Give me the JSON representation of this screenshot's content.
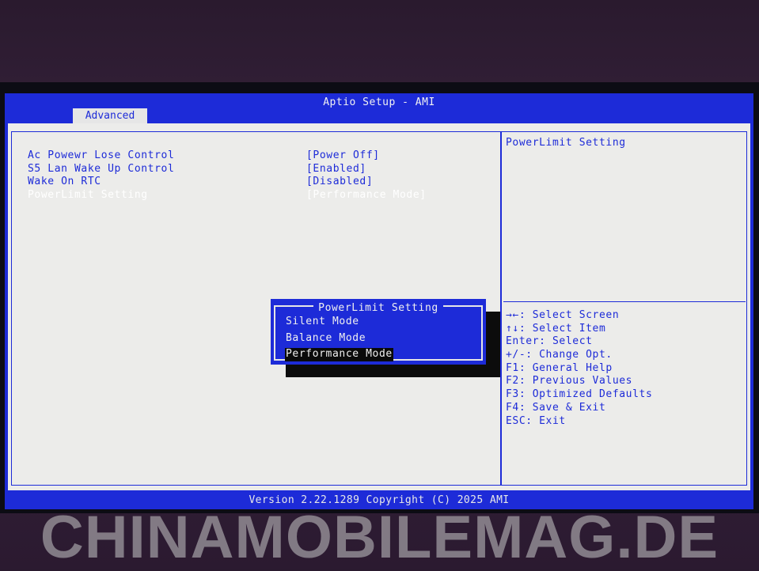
{
  "app_title": "Aptio Setup - AMI",
  "tabs": [
    {
      "label": "Advanced"
    }
  ],
  "settings": [
    {
      "label": "Ac Powewr Lose Control",
      "value": "[Power Off]"
    },
    {
      "label": "S5 Lan Wake Up Control",
      "value": "[Enabled]"
    },
    {
      "label": "Wake On RTC",
      "value": "[Disabled]"
    },
    {
      "label": "PowerLimit Setting",
      "value": "[Performance Mode]"
    }
  ],
  "help": {
    "title": "PowerLimit Setting"
  },
  "keys": [
    "→←: Select Screen",
    "↑↓: Select Item",
    "Enter: Select",
    "+/-: Change Opt.",
    "F1: General Help",
    "F2: Previous Values",
    "F3: Optimized Defaults",
    "F4: Save & Exit",
    "ESC: Exit"
  ],
  "popup": {
    "title": "PowerLimit Setting",
    "options": [
      "Silent Mode",
      "Balance Mode",
      "Performance Mode"
    ],
    "selected": "Performance Mode"
  },
  "footer": "Version 2.22.1289 Copyright (C) 2025 AMI",
  "watermark": "CHINAMOBILEMAG.DE",
  "colors": {
    "bios_blue": "#1d2bd8",
    "panel_bg": "#ececea",
    "selected_text": "#ffffff"
  }
}
